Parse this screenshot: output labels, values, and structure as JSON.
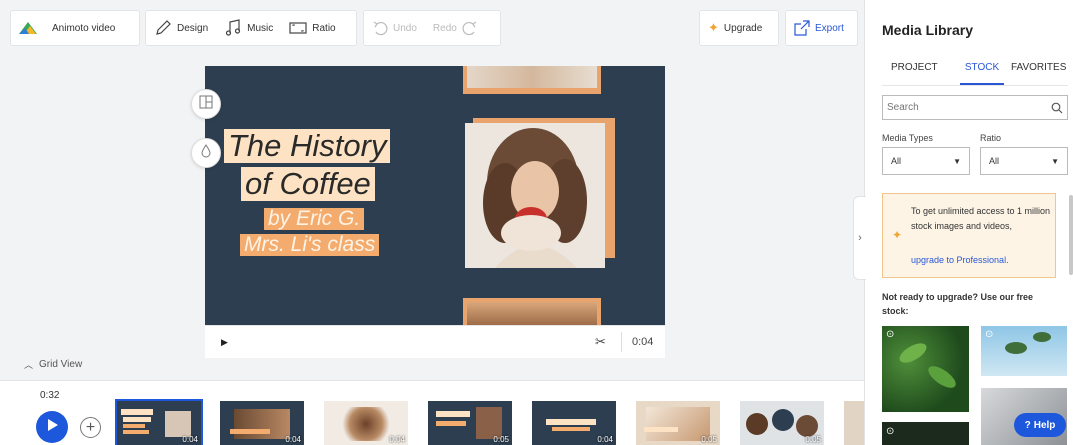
{
  "toolbar": {
    "project_name": "Animoto video",
    "design": "Design",
    "music": "Music",
    "ratio": "Ratio",
    "undo": "Undo",
    "redo": "Redo",
    "upgrade": "Upgrade",
    "export": "Export"
  },
  "slide": {
    "title_line1": "The History",
    "title_line2": "of Coffee",
    "sub_line1": "by Eric G.",
    "sub_line2": "Mrs. Li's class"
  },
  "player": {
    "time": "0:04"
  },
  "grid_view": "Grid View",
  "timeline": {
    "total_time": "0:32",
    "thumbnails": [
      {
        "duration": "0:04"
      },
      {
        "duration": "0:04"
      },
      {
        "duration": "0:04"
      },
      {
        "duration": "0:05"
      },
      {
        "duration": "0:04"
      },
      {
        "duration": "0:05"
      },
      {
        "duration": "0:05"
      }
    ]
  },
  "media_library": {
    "title": "Media Library",
    "tabs": [
      "PROJECT",
      "STOCK",
      "FAVORITES"
    ],
    "active_tab": "STOCK",
    "search_placeholder": "Search",
    "media_types_label": "Media Types",
    "media_types_value": "All",
    "ratio_label": "Ratio",
    "ratio_value": "All",
    "upgrade_text": "To get unlimited access to 1 million stock images and videos,",
    "upgrade_link": "upgrade to Professional.",
    "free_text": "Not ready to upgrade? Use our free stock:"
  },
  "help": "Help",
  "colors": {
    "accent": "#1d58dc",
    "slide_bg": "#2c3e50",
    "title_bg": "#fde3c4",
    "sub_bg": "#f4ac6e"
  }
}
